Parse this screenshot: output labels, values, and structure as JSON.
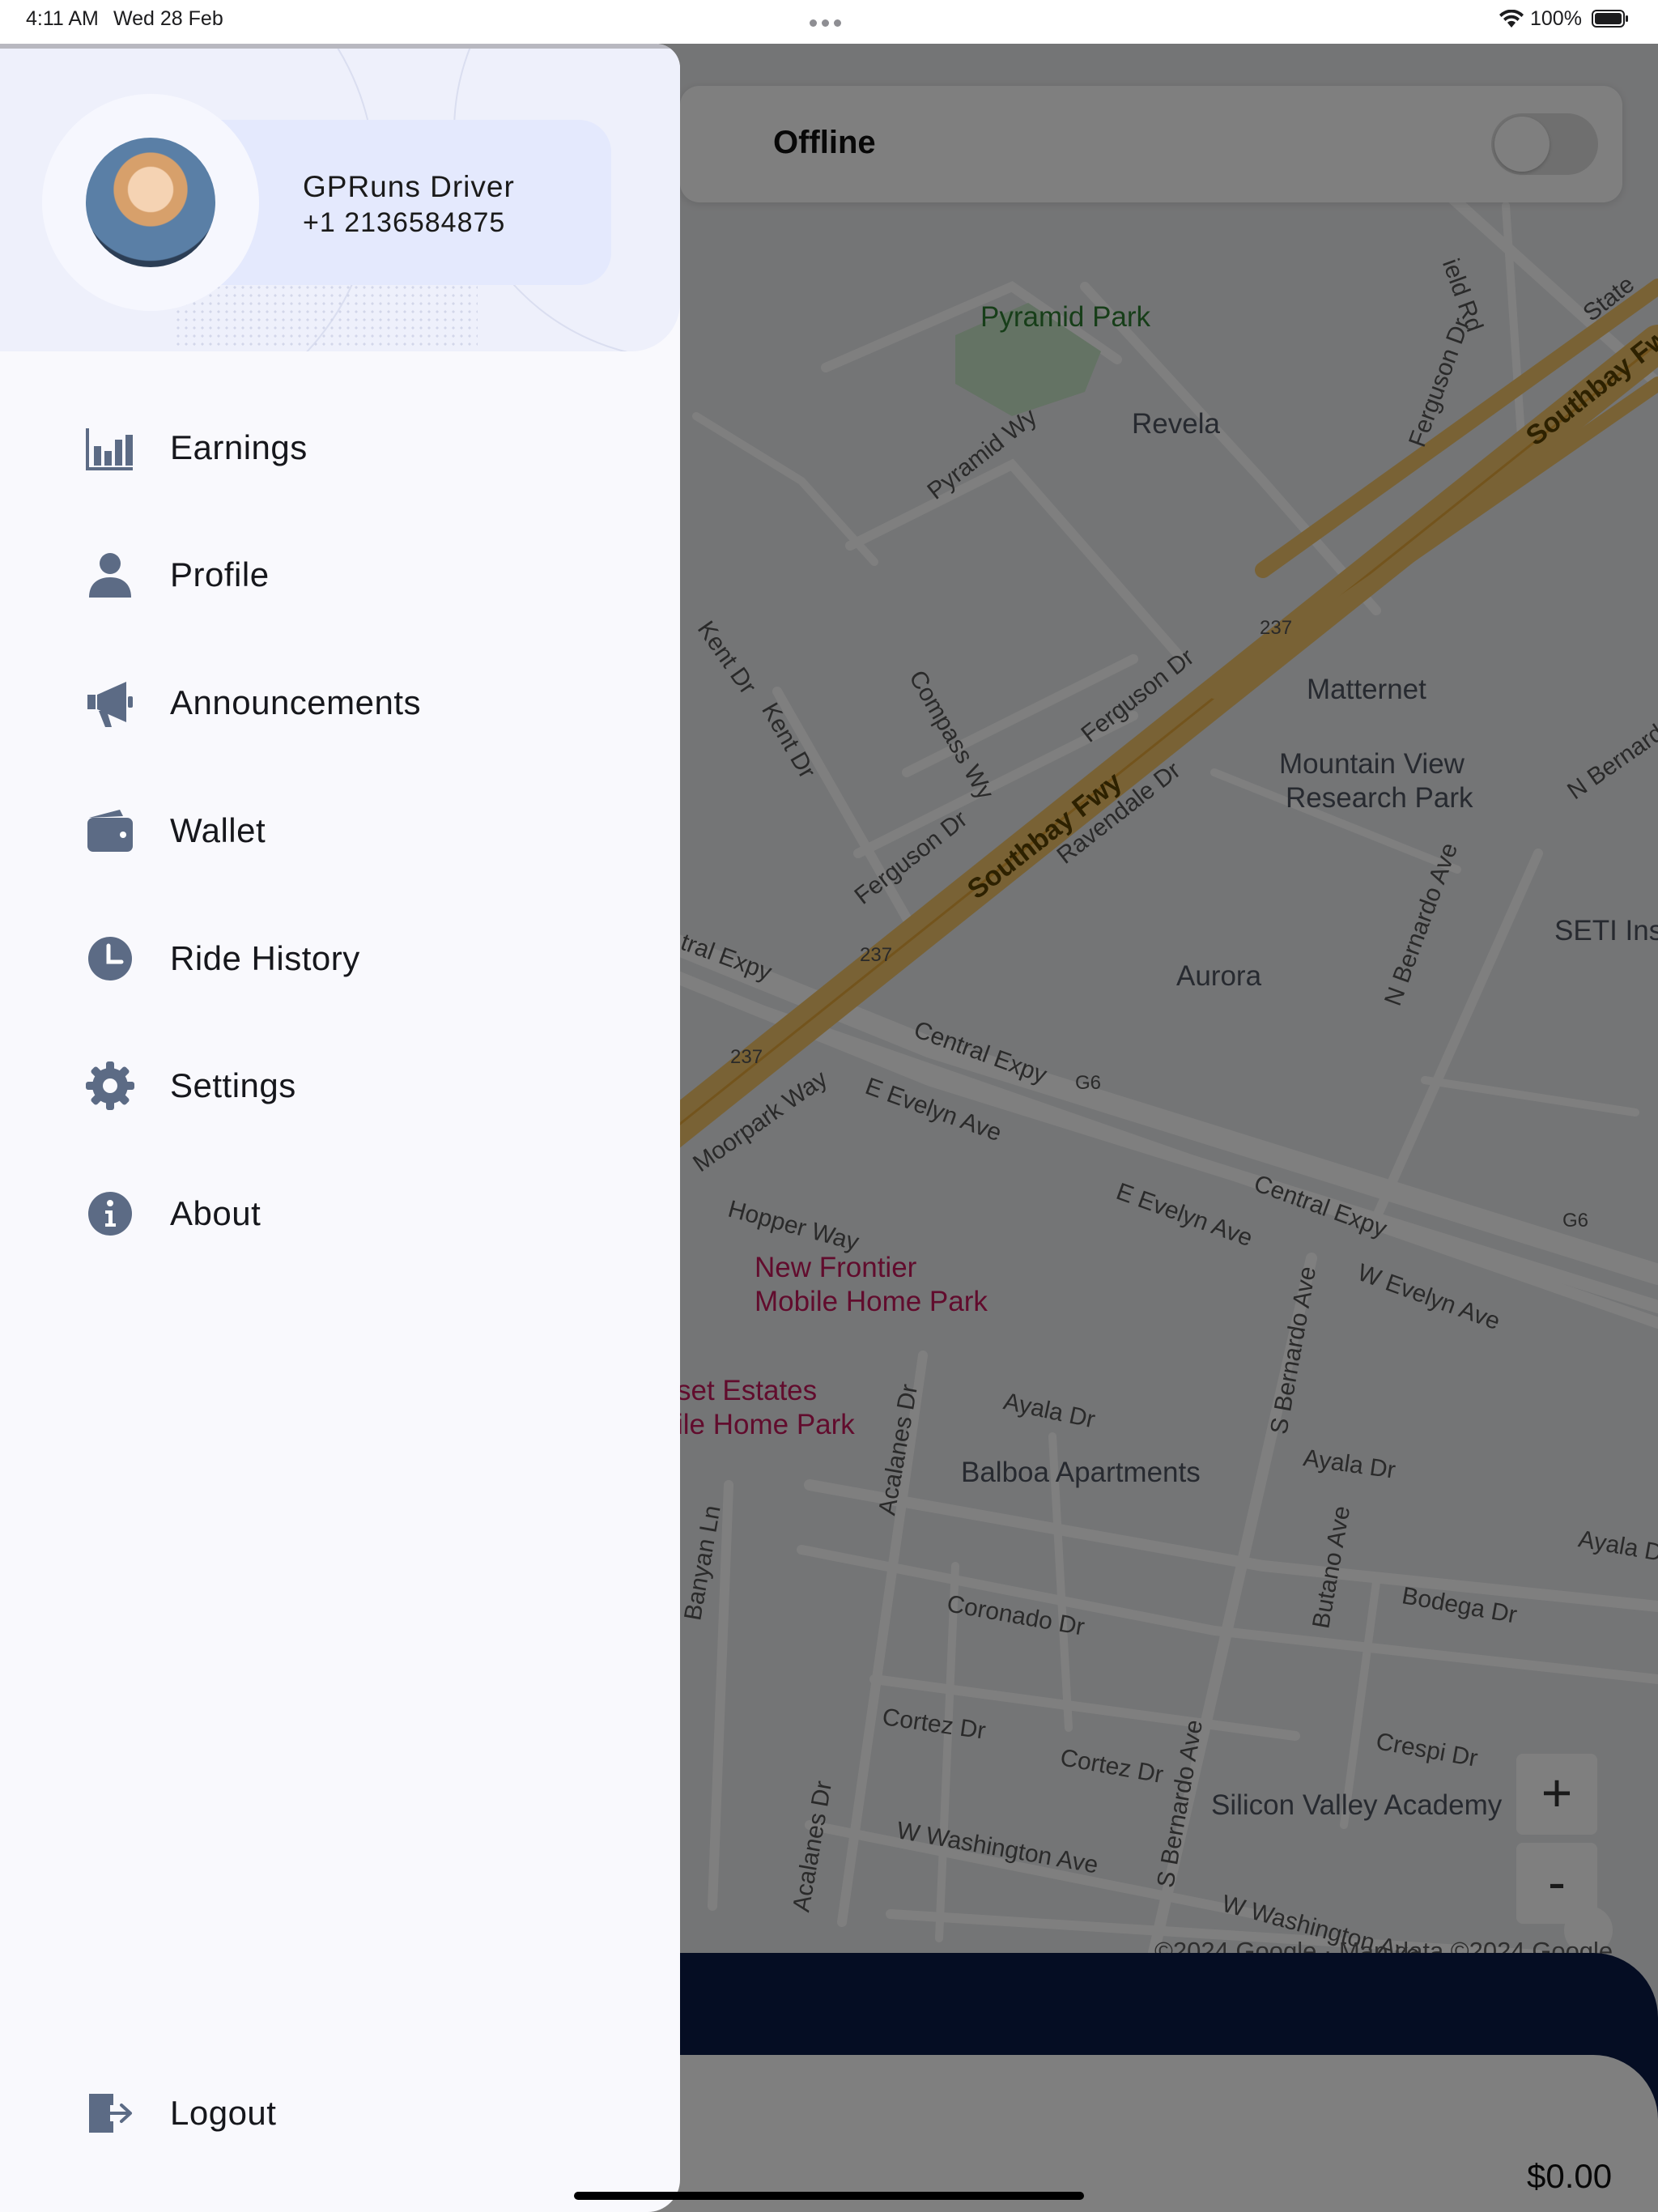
{
  "status_bar": {
    "time": "4:11 AM",
    "date": "Wed 28 Feb",
    "battery": "100%"
  },
  "drawer": {
    "user": {
      "name": "GPRuns Driver",
      "phone": "+1 2136584875"
    },
    "menu": [
      {
        "label": "Earnings",
        "icon": "bar-chart-icon"
      },
      {
        "label": "Profile",
        "icon": "person-icon"
      },
      {
        "label": "Announcements",
        "icon": "megaphone-icon"
      },
      {
        "label": "Wallet",
        "icon": "wallet-icon"
      },
      {
        "label": "Ride History",
        "icon": "clock-icon"
      },
      {
        "label": "Settings",
        "icon": "gear-icon"
      },
      {
        "label": "About",
        "icon": "info-icon"
      }
    ],
    "logout_label": "Logout"
  },
  "main": {
    "status_label": "Offline",
    "online_toggle": false,
    "balance": "$0.00"
  },
  "map": {
    "attribution": "©2024 Google · Map data ©2024 Google",
    "zoom_in": "+",
    "zoom_out": "-",
    "labels": {
      "pyramid_park": "Pyramid Park",
      "revela": "Revela",
      "matternet": "Matternet",
      "mountain_view_1": "Mountain View",
      "mountain_view_2": "Research Park",
      "aurora": "Aurora",
      "seti": "SETI Ins",
      "balboa": "Balboa Apartments",
      "silicon_valley": "Silicon Valley Academy",
      "new_frontier_1": "New Frontier",
      "new_frontier_2": "Mobile Home Park",
      "sunset_1": "set Estates",
      "sunset_2": "ile Home Park",
      "southbay_1": "Southbay Fwy",
      "southbay_2": "Southbay Fw",
      "central_1": "Central Expy",
      "central_2": "Central Expy",
      "central_3": "tral Expy",
      "evelyn_1": "E Evelyn Ave",
      "evelyn_2": "E Evelyn Ave",
      "evelyn_3": "W Evelyn Ave",
      "ferguson_1": "Ferguson Dr",
      "ferguson_2": "Ferguson Dr",
      "ferguson_3": "Ferguson Dr",
      "ravendale": "Ravendale Dr",
      "compass": "Compass Wy",
      "pyramid_wy": "Pyramid Wy",
      "kent_1": "Kent Dr",
      "kent_2": "Kent Dr",
      "moorpark": "Moorpark Way",
      "hopper": "Hopper Way",
      "ayala_1": "Ayala Dr",
      "ayala_2": "Ayala Dr",
      "ayala_3": "Ayala D",
      "coronado": "Coronado Dr",
      "cortez_1": "Cortez Dr",
      "cortez_2": "Cortez Dr",
      "washington_1": "W Washington Ave",
      "washington_2": "W Washington Ave",
      "bodega": "Bodega Dr",
      "crespi": "Crespi Dr",
      "n_bernardo": "N Bernardo Ave",
      "n_bernard": "N Bernard",
      "s_bernardo_1": "S Bernardo Ave",
      "s_bernardo_2": "S Bernardo Ave",
      "butano": "Butano Ave",
      "acalanes_1": "Acalanes Dr",
      "acalanes_2": "Acalanes Dr",
      "banyan": "Banyan Ln",
      "state": "State",
      "sheild": "ield Rd",
      "r237a": "237",
      "r237b": "237",
      "r237c": "237",
      "g6a": "G6",
      "g6b": "G6"
    }
  }
}
